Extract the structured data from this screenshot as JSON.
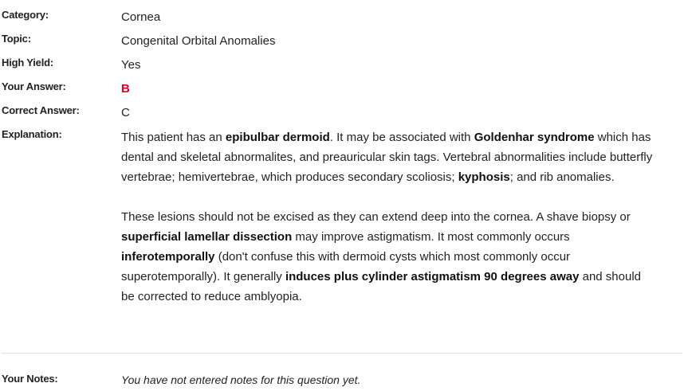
{
  "fields": {
    "category": {
      "label": "Category:",
      "value": "Cornea"
    },
    "topic": {
      "label": "Topic:",
      "value": "Congenital Orbital Anomalies"
    },
    "high_yield": {
      "label": "High Yield:",
      "value": "Yes"
    },
    "your_answer": {
      "label": "Your Answer:",
      "value": "B",
      "color": "#e0001b"
    },
    "correct_answer": {
      "label": "Correct Answer:",
      "value": "C"
    }
  },
  "explanation": {
    "label": "Explanation:",
    "p1": {
      "t1": "This patient has an ",
      "b1": "epibulbar dermoid",
      "t2": ". It may be associated with ",
      "b2": "Goldenhar syndrome",
      "t3": " which has dental and skeletal abnormalites, and preauricular skin tags. Vertebral abnormalities include butterfly vertebrae; hemivertebrae, which produces secondary scoliosis; ",
      "b3": "kyphosis",
      "t4": "; and rib anomalies."
    },
    "p2": {
      "t1": "These lesions should not be excised as they can extend deep into the cornea. A shave biopsy or ",
      "b1": "superficial lamellar dissection",
      "t2": " may improve astigmatism. It most commonly occurs ",
      "b2": "inferotemporally",
      "t3": " (don't confuse this with dermoid cysts which most commonly occur superotemporally).  It generally ",
      "b3": "induces plus cylinder astigmatism 90 degrees away",
      "t4": " and should be corrected to reduce amblyopia."
    }
  },
  "notes": {
    "label": "Your Notes:",
    "value": "You have not entered notes for this question yet."
  }
}
